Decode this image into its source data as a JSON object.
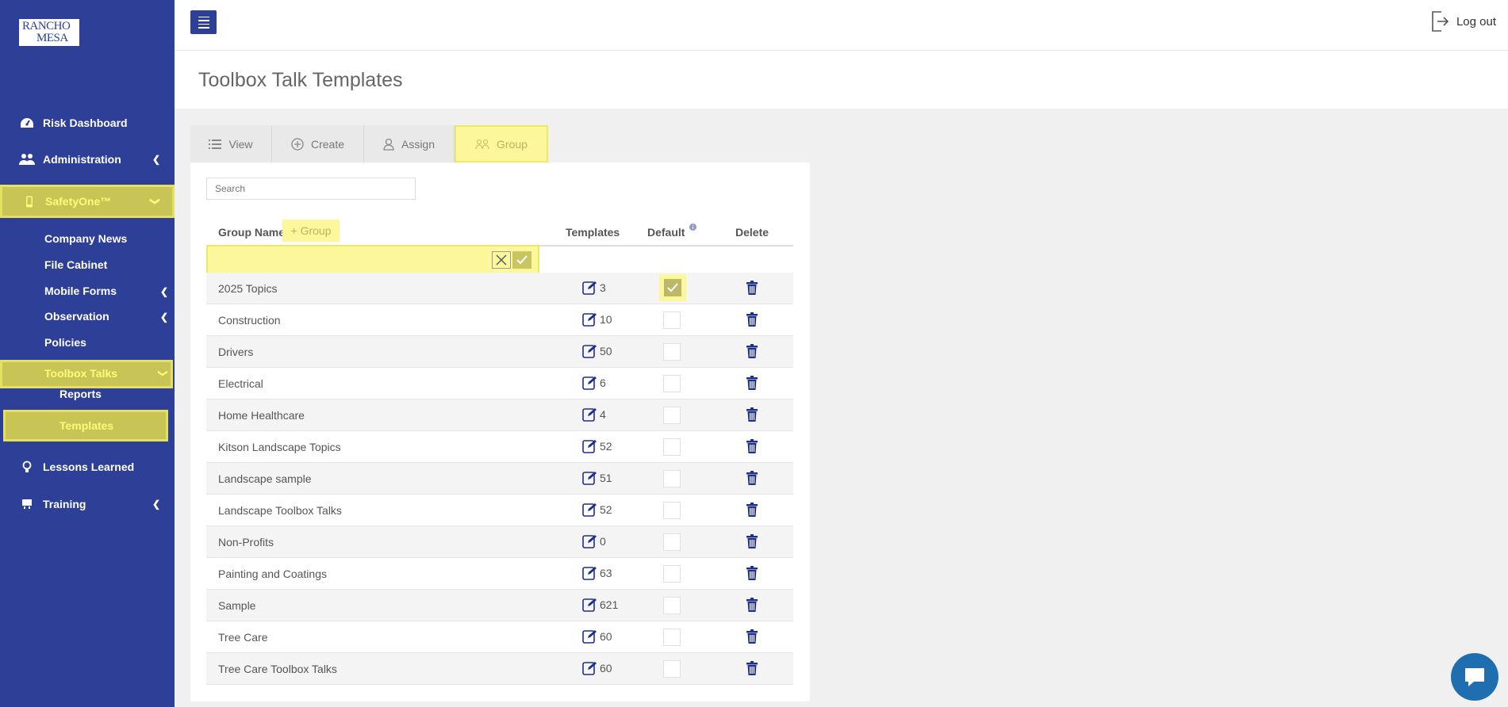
{
  "brand": {
    "logo_line1": "RANCHO",
    "logo_line2": "MESA"
  },
  "sidebar": {
    "items": [
      {
        "label": "Risk Dashboard",
        "icon": "dashboard-icon"
      },
      {
        "label": "Administration",
        "icon": "users-icon"
      },
      {
        "label": "SafetyOne™",
        "icon": "mobile-icon"
      },
      {
        "label": "Lessons Learned",
        "icon": "lightbulb-icon"
      },
      {
        "label": "Training",
        "icon": "training-icon"
      }
    ],
    "safetyone_sub": [
      "Company News",
      "File Cabinet",
      "Mobile Forms",
      "Observation",
      "Policies",
      "Toolbox Talks"
    ],
    "toolbox_sub": [
      "Reports",
      "Templates"
    ]
  },
  "topbar": {
    "logout_label": "Log out"
  },
  "page": {
    "title": "Toolbox Talk Templates"
  },
  "tabs": [
    "View",
    "Create",
    "Assign",
    "Group"
  ],
  "search": {
    "placeholder": "Search"
  },
  "table": {
    "headers": {
      "group_name": "Group Name",
      "add_group": "+ Group",
      "templates": "Templates",
      "default": "Default",
      "delete": "Delete"
    },
    "rows": [
      {
        "name": "2025 Topics",
        "count": "3",
        "default": true
      },
      {
        "name": "Construction",
        "count": "10",
        "default": false
      },
      {
        "name": "Drivers",
        "count": "50",
        "default": false
      },
      {
        "name": "Electrical",
        "count": "6",
        "default": false
      },
      {
        "name": "Home Healthcare",
        "count": "4",
        "default": false
      },
      {
        "name": "Kitson Landscape Topics",
        "count": "52",
        "default": false
      },
      {
        "name": "Landscape sample",
        "count": "51",
        "default": false
      },
      {
        "name": "Landscape Toolbox Talks",
        "count": "52",
        "default": false
      },
      {
        "name": "Non-Profits",
        "count": "0",
        "default": false
      },
      {
        "name": "Painting and Coatings",
        "count": "63",
        "default": false
      },
      {
        "name": "Sample",
        "count": "621",
        "default": false
      },
      {
        "name": "Tree Care",
        "count": "60",
        "default": false
      },
      {
        "name": "Tree Care Toolbox Talks",
        "count": "60",
        "default": false
      }
    ]
  },
  "colors": {
    "sidebar": "#2e3f97",
    "highlight": "#fbf79a",
    "accent": "#1f2f8a"
  }
}
